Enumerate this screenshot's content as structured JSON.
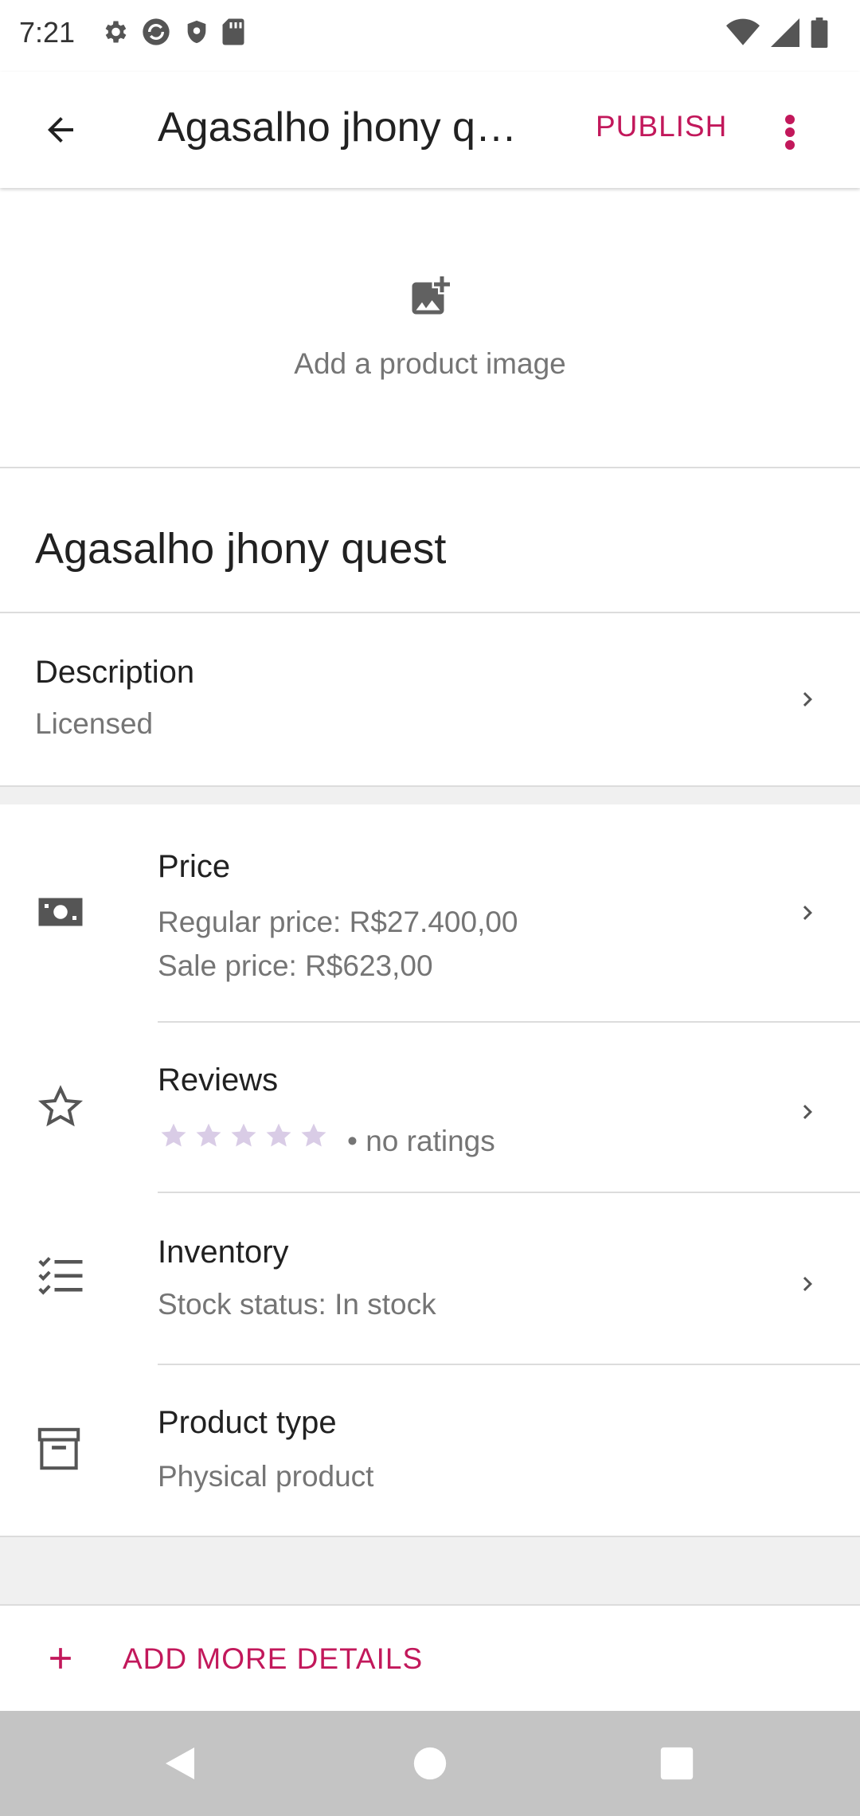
{
  "status_bar": {
    "time": "7:21",
    "left_icons": [
      "settings-icon",
      "sync-icon",
      "shield-icon",
      "sd-card-icon"
    ],
    "right_icons": [
      "wifi-icon",
      "signal-icon",
      "battery-icon"
    ]
  },
  "app_bar": {
    "title": "Agasalho jhony q…",
    "publish_label": "PUBLISH",
    "accent_color": "#c2185b"
  },
  "image_section": {
    "label": "Add a product image"
  },
  "product": {
    "title": "Agasalho jhony quest"
  },
  "description": {
    "title": "Description",
    "value": "Licensed"
  },
  "properties": [
    {
      "title": "Price",
      "icon": "money-icon",
      "lines": [
        "Regular price: R$27.400,00",
        "Sale price: R$623,00"
      ]
    },
    {
      "title": "Reviews",
      "icon": "star-outline-icon",
      "rating_stars": 5,
      "rating_text": "• no ratings"
    },
    {
      "title": "Inventory",
      "icon": "checklist-icon",
      "lines": [
        "Stock status: In stock"
      ]
    },
    {
      "title": "Product type",
      "icon": "archive-box-icon",
      "lines": [
        "Physical product"
      ]
    }
  ],
  "footer": {
    "add_more_label": "ADD MORE DETAILS"
  },
  "nav_bar": {
    "buttons": [
      "back-triangle-icon",
      "home-circle-icon",
      "recents-square-icon"
    ]
  }
}
